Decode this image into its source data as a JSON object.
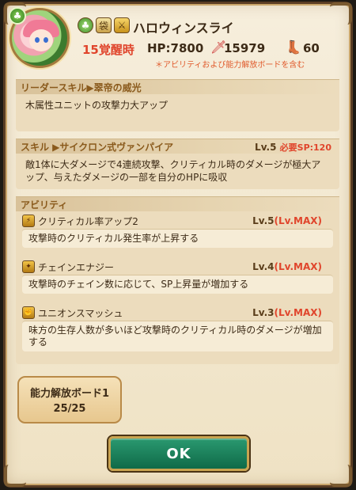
{
  "unit": {
    "name": "ハロウィンスライ",
    "awaken": "15覚醒時",
    "hp": "HP:7800",
    "atk": "15979",
    "speed": "60",
    "note": "＊アビリティおよび能力解放ボードを含む"
  },
  "leader": {
    "header": "リーダースキル▶翠帝の威光",
    "desc": "木属性ユニットの攻撃力大アップ"
  },
  "skill": {
    "header": "スキル ▶サイクロン式ヴァンパイア",
    "level": "Lv.5",
    "required_sp": "必要SP:120",
    "desc": "敵1体に大ダメージで4連続攻撃、クリティカル時のダメージが極大アップ、与えたダメージの一部を自分のHPに吸収"
  },
  "abilities": {
    "header": "アビリティ",
    "items": [
      {
        "name": "クリティカル率アップ2",
        "level": "Lv.5",
        "max": "(Lv.MAX)",
        "desc": "攻撃時のクリティカル発生率が上昇する"
      },
      {
        "name": "チェインエナジー",
        "level": "Lv.4",
        "max": "(Lv.MAX)",
        "desc": "攻撃時のチェイン数に応じて、SP上昇量が増加する"
      },
      {
        "name": "ユニオンスマッシュ",
        "level": "Lv.3",
        "max": "(Lv.MAX)",
        "desc": "味方の生存人数が多いほど攻撃時のクリティカル時のダメージが増加する"
      }
    ]
  },
  "board": {
    "label": "能力解放ボード1",
    "progress": "25/25"
  },
  "ok_label": "OK"
}
